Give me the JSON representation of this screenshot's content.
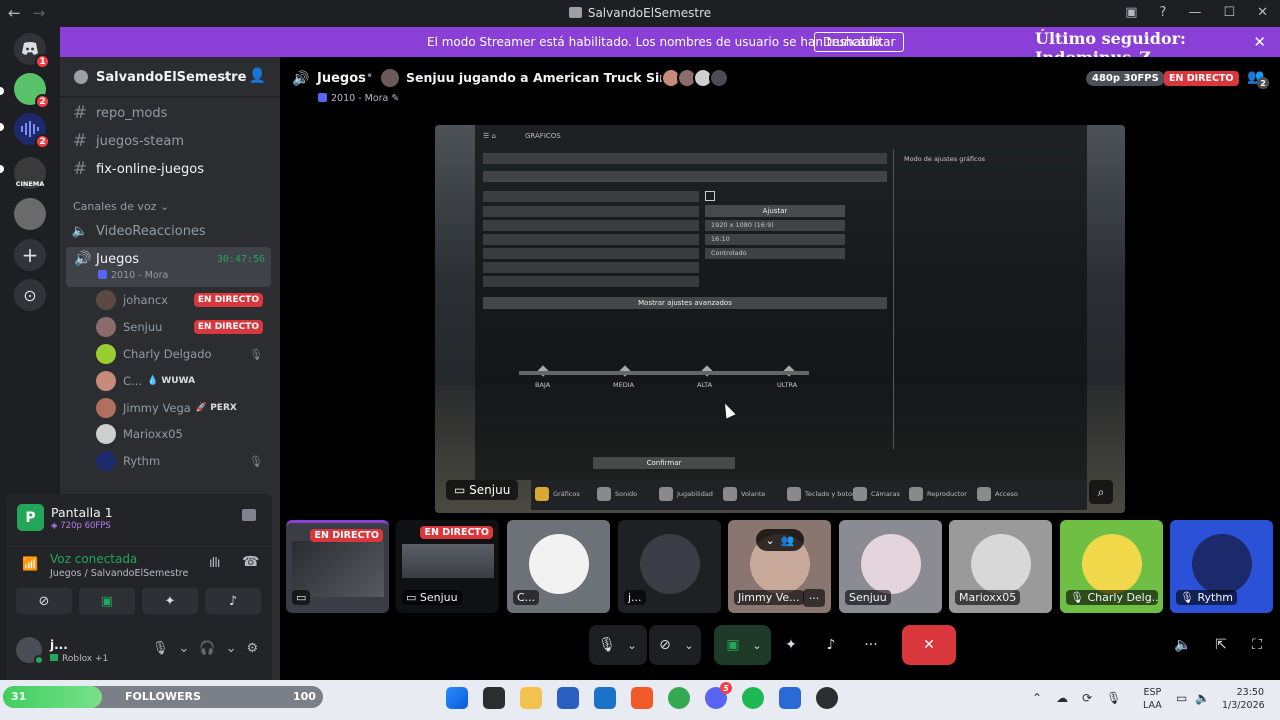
{
  "window": {
    "title": "SalvandoElSemestre",
    "back": "←",
    "forward": "→"
  },
  "rail": {
    "badges": [
      "1",
      "2",
      "2"
    ],
    "cinema_label": "CINEMA",
    "add_server": "+",
    "explore": "⊙"
  },
  "banner": {
    "text": "El modo Streamer está habilitado. Los nombres de usuario se han truncado.",
    "button": "Deshabilitar",
    "follower": "Último seguidor: Indominus_Z",
    "close": "✕"
  },
  "sidebar": {
    "server_name": "SalvandoElSemestre",
    "channels": [
      {
        "name": "repo_mods"
      },
      {
        "name": "juegos-steam"
      },
      {
        "name": "fix-online-juegos"
      }
    ],
    "voice_category": "Canales de voz",
    "voice_channels": [
      {
        "name": "VideoReacciones"
      },
      {
        "name": "Juegos",
        "timer": "30:47:56",
        "activity": "2010 - Mora"
      }
    ],
    "voice_users": [
      {
        "name": "johancx",
        "live": "EN DIRECTO"
      },
      {
        "name": "Senjuu",
        "live": "EN DIRECTO"
      },
      {
        "name": "Charly Delgado"
      },
      {
        "name": "C...",
        "tag": "💧 WUWA"
      },
      {
        "name": "Jimmy Vega",
        "tag": "🚀 PERX"
      },
      {
        "name": "Marioxx05"
      },
      {
        "name": "Rythm"
      }
    ]
  },
  "screen_panel": {
    "icon_letter": "P",
    "title": "Pantalla 1",
    "quality": "720p 60FPS"
  },
  "voice_panel": {
    "status": "Voz conectada",
    "location": "Juegos / SalvandoElSemestre"
  },
  "user_bar": {
    "name": "j...",
    "status": "Roblox +1"
  },
  "main_header": {
    "channel": "Juegos",
    "stream_title": "Senjuu jugando a American Truck Simulator",
    "activity": "2010 - Mora",
    "quality": "480p 30FPS",
    "live": "EN DIRECTO",
    "viewers": "2"
  },
  "stream": {
    "streamer": "Senjuu",
    "game": {
      "top_label": "GRÁFICOS",
      "section": "Modo de ajustes gráficos",
      "button_apply": "Ajustar",
      "row_values": [
        "1920 x 1080 (16:9)",
        "16:10",
        "Controlado"
      ],
      "show_advanced": "Mostrar ajustes avanzados",
      "preset_levels": [
        "BAJA",
        "MEDIA",
        "ALTA",
        "ULTRA"
      ],
      "confirm": "Confirmar",
      "bottom_tabs": [
        "Gráficos",
        "Sonido",
        "Jugabilidad",
        "Volante",
        "Teclado y botones",
        "Cámaras",
        "Reproductor",
        "Acceso"
      ]
    }
  },
  "tiles": [
    {
      "label": "",
      "live": "EN DIRECTO"
    },
    {
      "label": "Senjuu",
      "live": "EN DIRECTO"
    },
    {
      "label": "C..."
    },
    {
      "label": "j..."
    },
    {
      "label": "Jimmy Ve...",
      "more": "···"
    },
    {
      "label": "Senjuu"
    },
    {
      "label": "Marioxx05"
    },
    {
      "label": "Charly Delg..."
    },
    {
      "label": "Rythm"
    }
  ],
  "taskbar": {
    "followers_count": "31",
    "followers_label": "FOLLOWERS",
    "followers_goal": "100",
    "followers_progress": 0.31,
    "discord_badge": "5",
    "lang_top": "ESP",
    "lang_bottom": "LAA",
    "time": "23:50",
    "date": "1/3/2026"
  },
  "colors": {
    "banner": "#8a3fd6",
    "live": "#da373c",
    "connected": "#23a55a",
    "blurple": "#5865f2"
  }
}
